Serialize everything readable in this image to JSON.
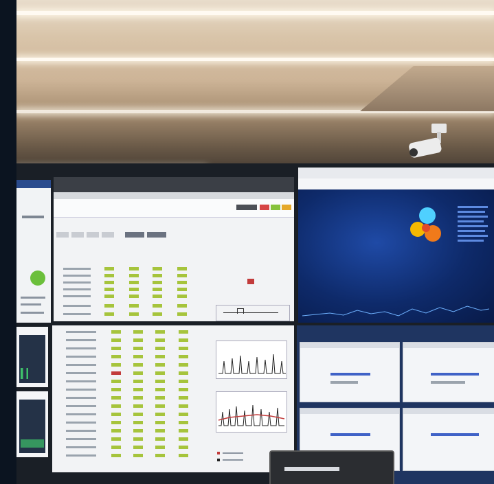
{
  "scene": {
    "description_tag": "control-room-video-wall",
    "colors": {
      "ceiling": "#d9c5aa",
      "monitor_dark": "#0f2b63",
      "sheet": "#eceef1",
      "accent_green": "#a6c43c",
      "accent_blue": "#3f62c7",
      "ring_cyan": "#4fd0ff",
      "ring_yellow": "#f5b800",
      "ring_orange": "#f07a1a"
    }
  }
}
